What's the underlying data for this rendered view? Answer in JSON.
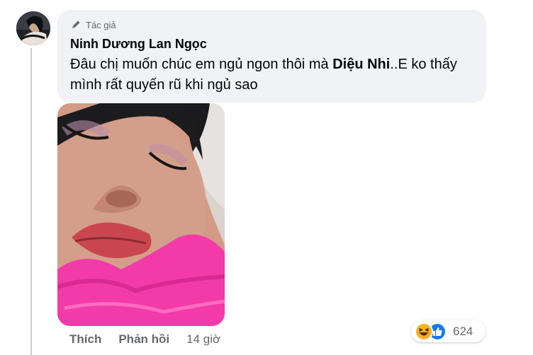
{
  "comment": {
    "badge_label": "Tác giả",
    "author": "Ninh Dương Lan Ngọc",
    "text_before": "Đâu chị muốn chúc em ngủ ngon thôi mà ",
    "mention": "Diệu Nhi",
    "text_after": "..E ko thấy mình rất quyến rũ khi ngủ sao"
  },
  "actions": {
    "like_label": "Thích",
    "reply_label": "Phản hồi",
    "timestamp": "14 giờ"
  },
  "reactions": {
    "count": "624",
    "icons": [
      "haha-reaction-icon",
      "like-reaction-icon"
    ]
  },
  "colors": {
    "bubble_bg": "#f0f2f5",
    "secondary_text": "#65676b",
    "like_blue": "#1877f2",
    "haha_yellow": "#f7b125",
    "photo_blanket_pink": "#f23aa8"
  }
}
